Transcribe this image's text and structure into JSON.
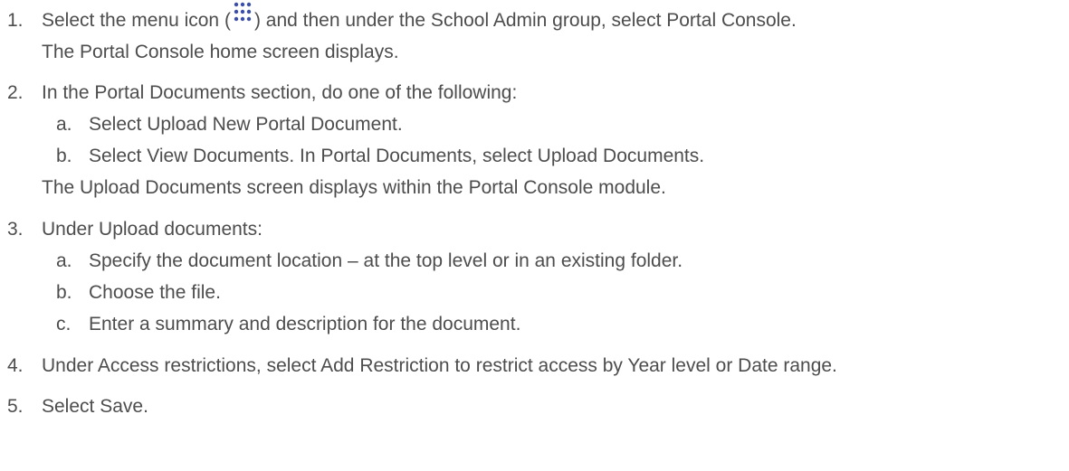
{
  "accent_color": "#3b4fa8",
  "icon": "menu-dots-icon",
  "steps": [
    {
      "num": "1.",
      "text_before": "Select the menu icon (",
      "text_after": ") and then under the School Admin group, select Portal Console.",
      "result": "The Portal Console home screen displays."
    },
    {
      "num": "2.",
      "text": "In the Portal Documents section, do one of the following:",
      "subs": [
        {
          "letter": "a.",
          "text": "Select Upload New Portal Document."
        },
        {
          "letter": "b.",
          "text": "Select View Documents. In Portal Documents, select Upload Documents."
        }
      ],
      "result": "The Upload Documents screen displays within the Portal Console module."
    },
    {
      "num": "3.",
      "text": "Under Upload documents:",
      "subs": [
        {
          "letter": "a.",
          "text": "Specify the document location – at the top level or in an existing folder."
        },
        {
          "letter": "b.",
          "text": "Choose the file."
        },
        {
          "letter": "c.",
          "text": "Enter a summary and description for the document."
        }
      ]
    },
    {
      "num": "4.",
      "text": "Under Access restrictions, select Add Restriction to restrict access by Year level or Date range."
    },
    {
      "num": "5.",
      "text": "Select Save."
    }
  ]
}
